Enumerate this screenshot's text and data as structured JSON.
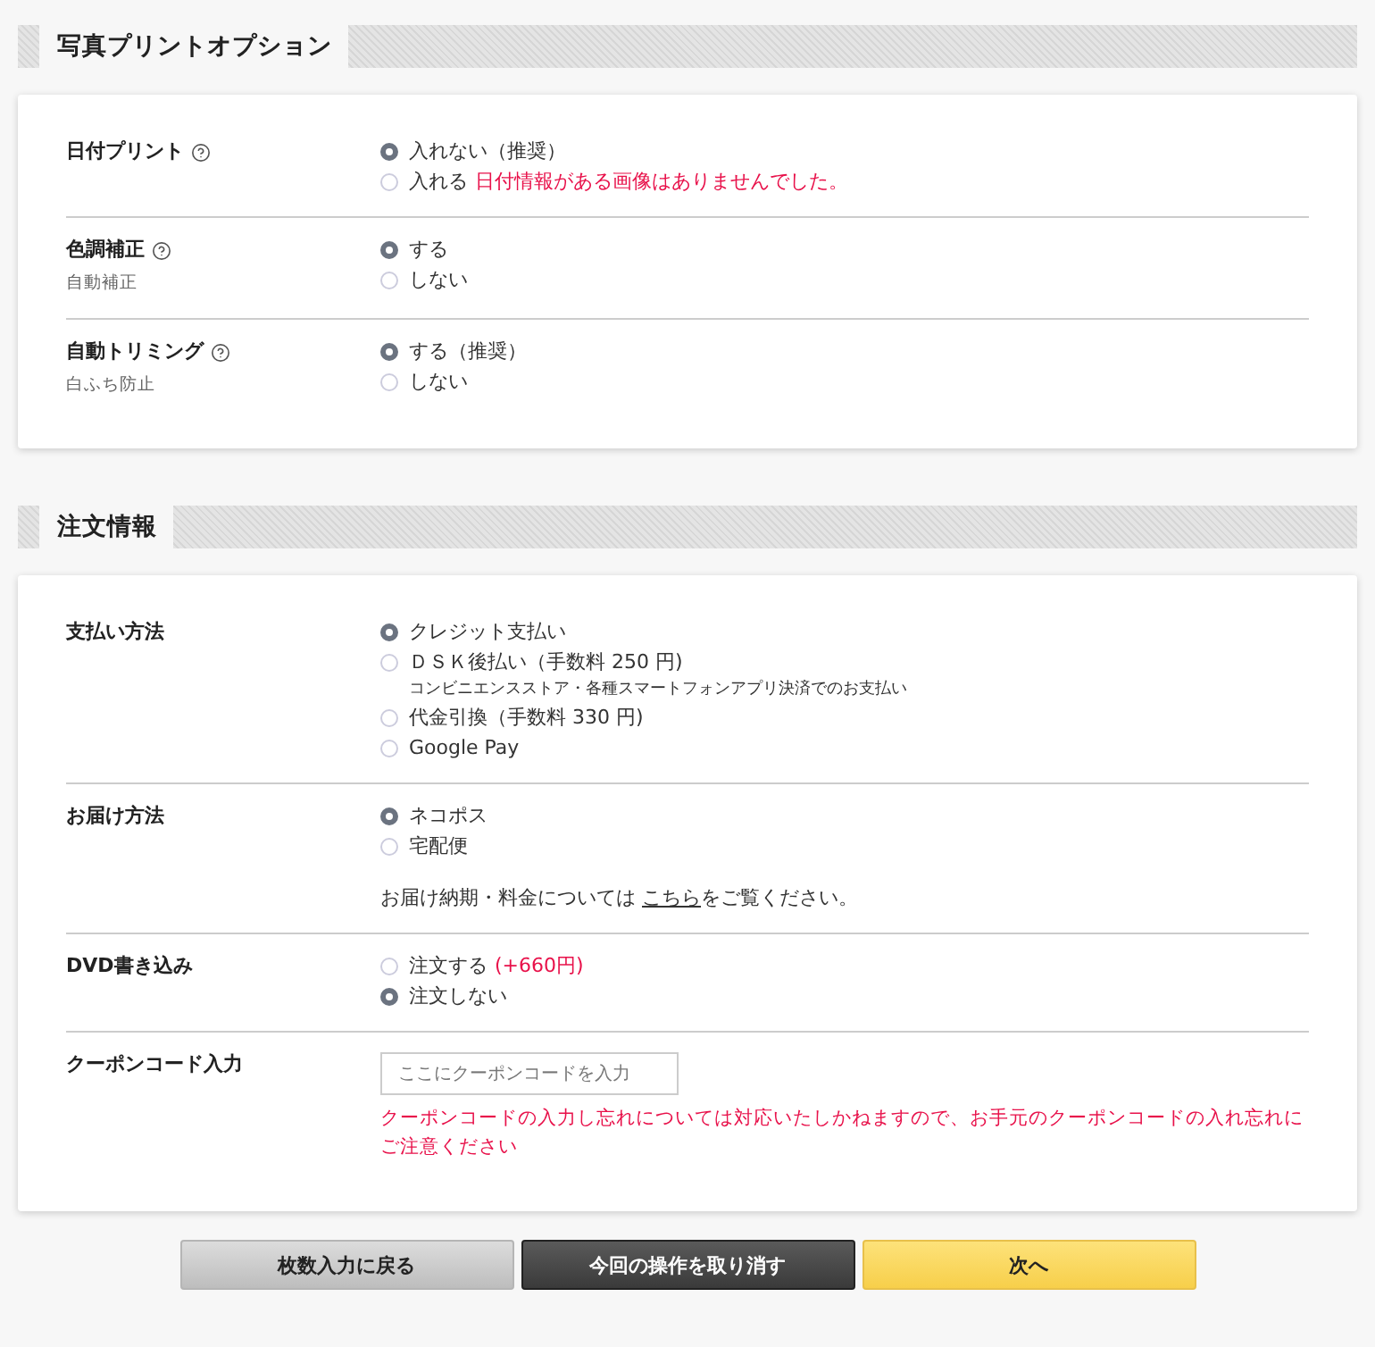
{
  "sections": [
    {
      "title": "写真プリントオプション",
      "rows": [
        {
          "kind": "radio",
          "label": "日付プリント",
          "help": true,
          "options": [
            {
              "label": "入れない（推奨）",
              "selected": true
            },
            {
              "label": "入れる",
              "selected": false,
              "note": "日付情報がある画像はありませんでした。"
            }
          ]
        },
        {
          "kind": "radio",
          "label": "色調補正",
          "help": true,
          "sublabel": "自動補正",
          "options": [
            {
              "label": "する",
              "selected": true
            },
            {
              "label": "しない",
              "selected": false
            }
          ]
        },
        {
          "kind": "radio",
          "label": "自動トリミング",
          "help": true,
          "sublabel": "白ふち防止",
          "options": [
            {
              "label": "する（推奨）",
              "selected": true
            },
            {
              "label": "しない",
              "selected": false
            }
          ]
        }
      ]
    },
    {
      "title": "注文情報",
      "rows": [
        {
          "kind": "radio",
          "label": "支払い方法",
          "options": [
            {
              "label": "クレジット支払い",
              "selected": true
            },
            {
              "label": "ＤＳＫ後払い（手数料 250 円)",
              "selected": false,
              "caption": "コンビニエンスストア・各種スマートフォンアプリ決済でのお支払い"
            },
            {
              "label": "代金引換（手数料 330 円)",
              "selected": false
            },
            {
              "label": "Google Pay",
              "selected": false
            }
          ]
        },
        {
          "kind": "radio",
          "label": "お届け方法",
          "options": [
            {
              "label": "ネコポス",
              "selected": true
            },
            {
              "label": "宅配便",
              "selected": false
            }
          ],
          "info": {
            "before": "お届け納期・料金については ",
            "link": "こちら",
            "after": "をご覧ください。"
          }
        },
        {
          "kind": "radio",
          "label": "DVD書き込み",
          "options": [
            {
              "label": "注文する",
              "selected": false,
              "note": "(+660円)"
            },
            {
              "label": "注文しない",
              "selected": true
            }
          ]
        },
        {
          "kind": "coupon",
          "label": "クーポンコード入力",
          "placeholder": "ここにクーポンコードを入力",
          "warning": "クーポンコードの入力し忘れについては対応いたしかねますので、お手元のクーポンコードの入れ忘れにご注意ください"
        }
      ]
    }
  ],
  "buttons": [
    {
      "label": "枚数入力に戻る",
      "kind": "back"
    },
    {
      "label": "今回の操作を取り消す",
      "kind": "cancel"
    },
    {
      "label": "次へ",
      "kind": "next"
    }
  ]
}
